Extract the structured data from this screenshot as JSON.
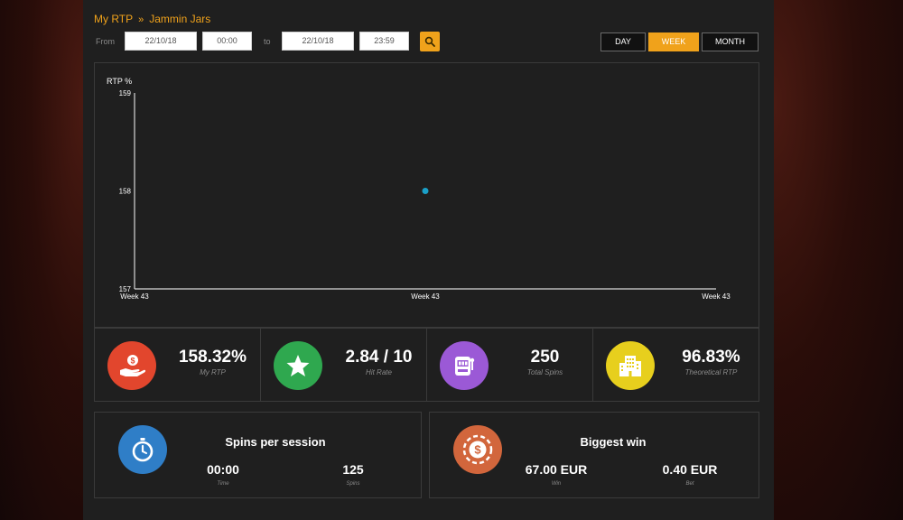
{
  "breadcrumb": {
    "root": "My RTP",
    "separator": "»",
    "current": "Jammin Jars"
  },
  "filters": {
    "from_label": "From",
    "from_date": "22/10/18",
    "from_time": "00:00",
    "to_label": "to",
    "to_date": "22/10/18",
    "to_time": "23:59"
  },
  "period_buttons": [
    {
      "label": "DAY",
      "active": false
    },
    {
      "label": "WEEK",
      "active": true
    },
    {
      "label": "MONTH",
      "active": false
    }
  ],
  "chart_data": {
    "type": "scatter",
    "ylabel": "RTP %",
    "x_ticks": [
      "Week 43",
      "Week 43",
      "Week 43"
    ],
    "y_ticks": [
      157,
      158,
      159
    ],
    "ylim": [
      157,
      159
    ],
    "series": [
      {
        "color": "#1aa0c8",
        "x": [
          "Week 43"
        ],
        "y": [
          158
        ]
      }
    ]
  },
  "stats": [
    {
      "value": "158.32%",
      "label": "My RTP",
      "icon": "hand-money-icon",
      "color": "#e2462d"
    },
    {
      "value": "2.84 / 10",
      "label": "Hit Rate",
      "icon": "star-icon",
      "color": "#2fa84f"
    },
    {
      "value": "250",
      "label": "Total Spins",
      "icon": "slot-machine-icon",
      "color": "#9b59d6"
    },
    {
      "value": "96.83%",
      "label": "Theoretical RTP",
      "icon": "building-icon",
      "color": "#e7cf1d"
    }
  ],
  "spins_per_session": {
    "title": "Spins per session",
    "time_value": "00:00",
    "time_label": "Time",
    "spins_value": "125",
    "spins_label": "Spins",
    "icon": "stopwatch-icon",
    "color": "#2f7ec7"
  },
  "biggest_win": {
    "title": "Biggest win",
    "win_value": "67.00 EUR",
    "win_label": "Win",
    "bet_value": "0.40 EUR",
    "bet_label": "Bet",
    "icon": "casino-chip-icon",
    "color": "#d2663c"
  }
}
